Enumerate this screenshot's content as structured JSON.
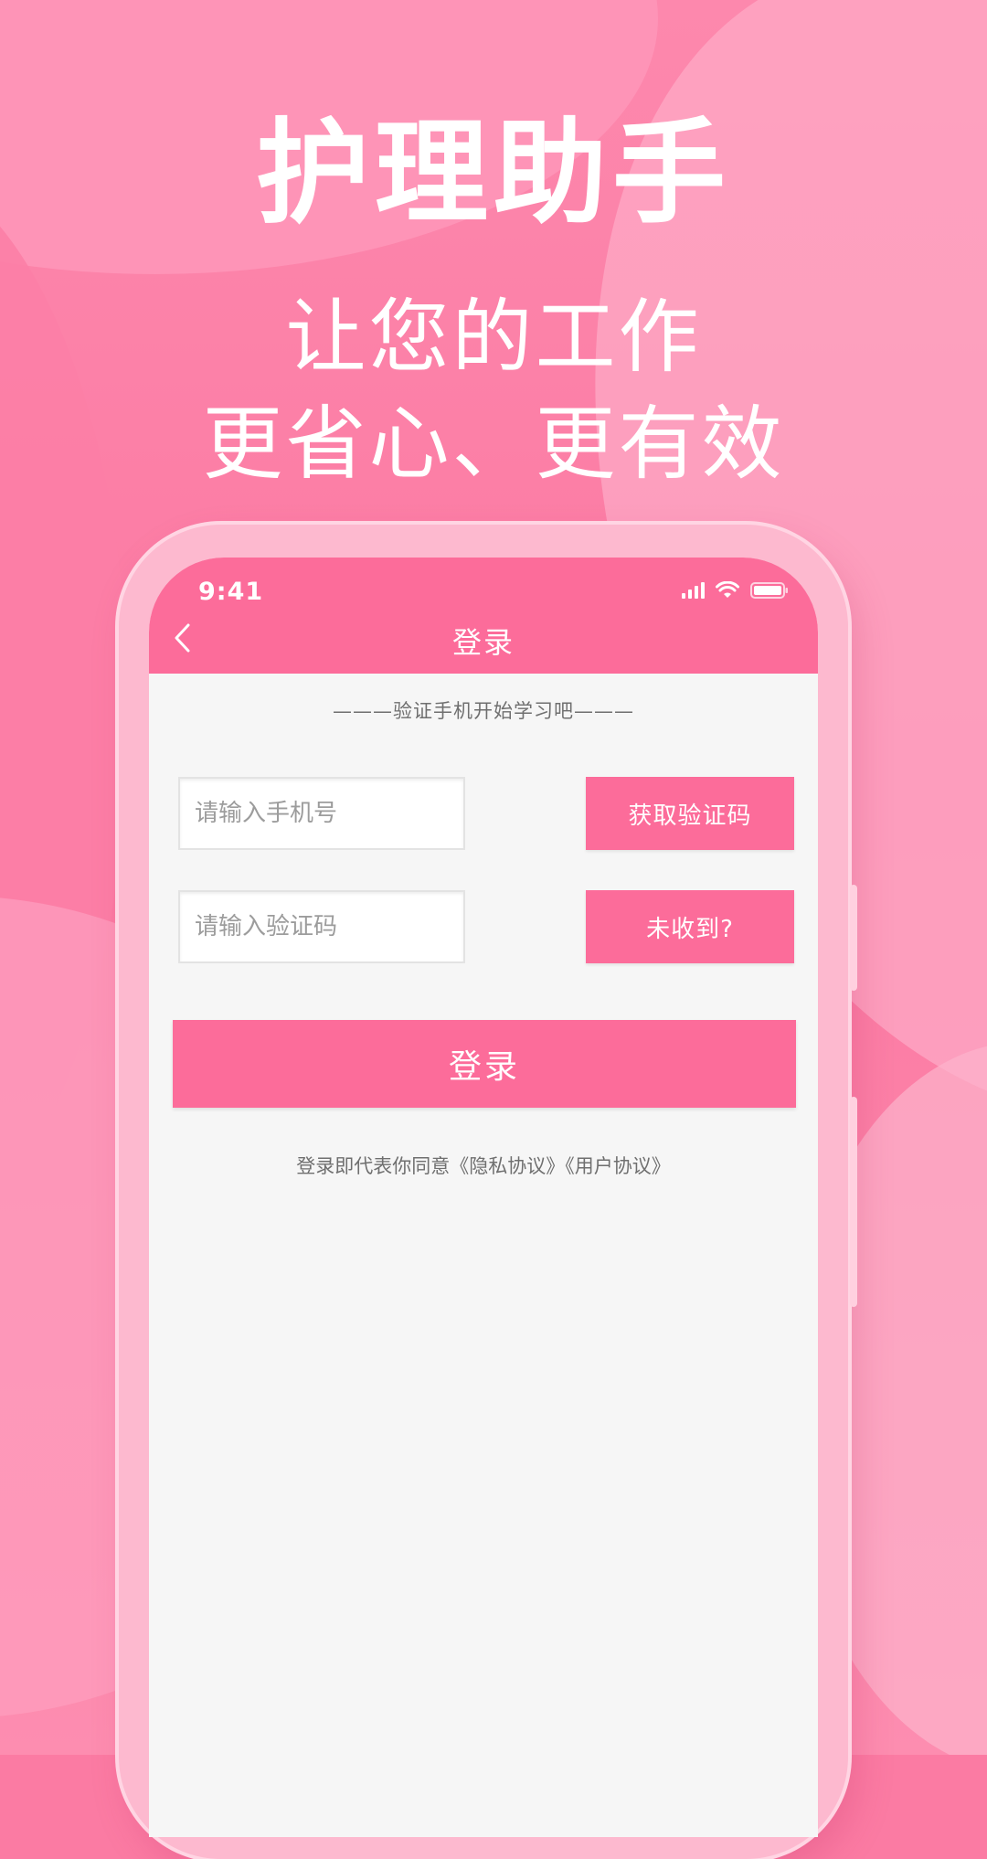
{
  "hero": {
    "title": "护理助手",
    "line1": "让您的工作",
    "line2": "更省心、更有效"
  },
  "status_bar": {
    "time": "9:41",
    "icons": [
      "signal-icon",
      "wifi-icon",
      "battery-icon"
    ]
  },
  "nav": {
    "back_icon": "chevron-left-icon",
    "title": "登录"
  },
  "form": {
    "subtitle": "———验证手机开始学习吧———",
    "phone_placeholder": "请输入手机号",
    "phone_value": "",
    "get_code_label": "获取验证码",
    "code_placeholder": "请输入验证码",
    "code_value": "",
    "not_received_label": "未收到?",
    "login_label": "登录"
  },
  "agreement": {
    "prefix": "登录即代表你同意",
    "privacy_link": "《隐私协议》",
    "user_link": "《用户协议》"
  },
  "colors": {
    "accent": "#fc6c9a",
    "background_pink": "#fb7ba3",
    "screen_bg": "#f6f6f6",
    "muted_text": "#6f6f6f"
  }
}
